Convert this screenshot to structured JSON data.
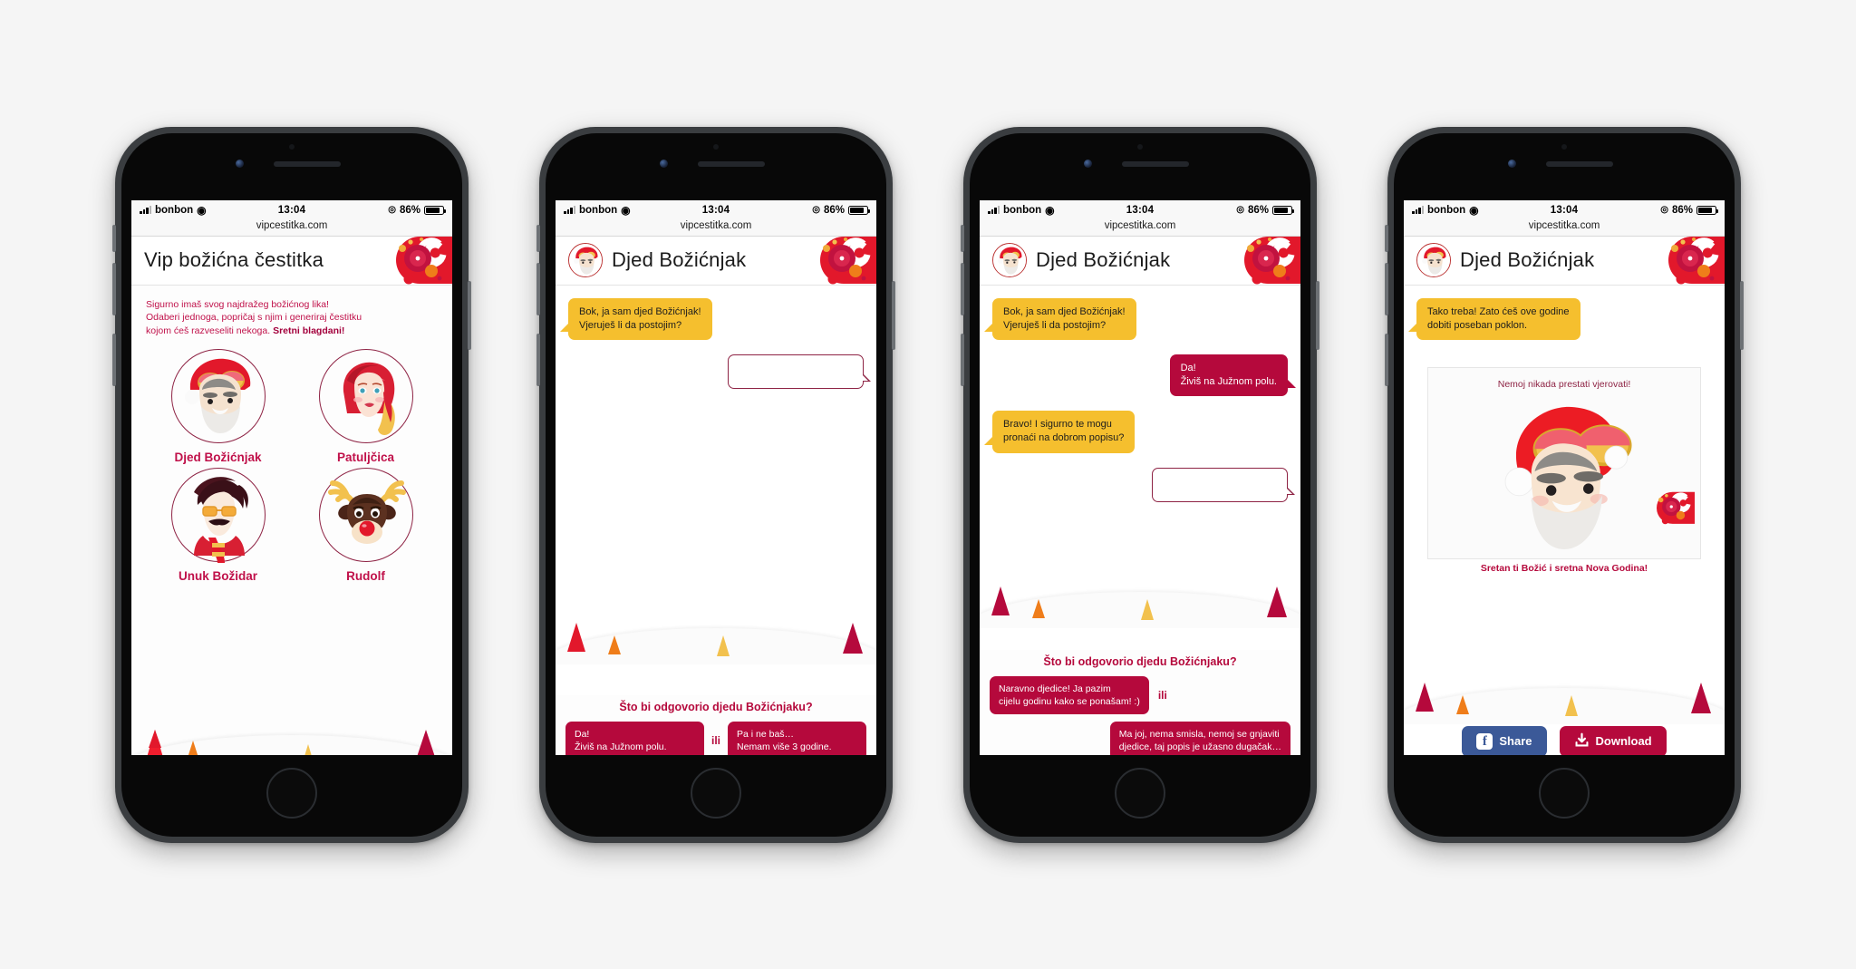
{
  "status_bar": {
    "carrier": "bonbon",
    "time": "13:04",
    "battery_percent": "86%",
    "wifi_icon": "wifi-icon",
    "signal_icon": "signal-bars-icon",
    "location_icon": "location-arrow-icon",
    "battery_icon": "battery-icon"
  },
  "browser": {
    "url": "vipcestitka.com"
  },
  "brand": {
    "logo_name": "vip-bubbles-logo",
    "accent_red": "#b5093c",
    "accent_yellow": "#f5bf2e",
    "dark_red": "#8e2344"
  },
  "phones": [
    {
      "id": "phone-1-character-select",
      "header": {
        "title": "Vip božićna čestitka",
        "has_avatar": false
      },
      "intro": {
        "line1": "Sigurno imaš svog najdražeg božićnog lika!",
        "line2": "Odaberi jednoga, popričaj s njim i generiraj čestitku",
        "line3_plain": "kojom ćeš razveseliti nekoga. ",
        "line3_bold": "Sretni blagdani!"
      },
      "characters": [
        {
          "name": "Djed Božićnjak",
          "avatar": "santa-avatar"
        },
        {
          "name": "Patuljčica",
          "avatar": "elf-girl-avatar"
        },
        {
          "name": "Unuk Božidar",
          "avatar": "hipster-grandson-avatar"
        },
        {
          "name": "Rudolf",
          "avatar": "reindeer-avatar"
        }
      ]
    },
    {
      "id": "phone-2-chat-start",
      "header": {
        "title": "Djed Božićnjak",
        "has_avatar": true,
        "avatar": "santa-avatar"
      },
      "messages": [
        {
          "from": "santa",
          "text": "Bok, ja sam djed Božićnjak!\nVjeruješ li da postojim?"
        },
        {
          "from": "me",
          "text": "",
          "empty": true
        }
      ],
      "answers": {
        "question": "Što bi odgovorio djedu Božićnjaku?",
        "separator": "ili",
        "options": [
          "Da!\nŽiviš na Južnom polu.",
          "Pa i ne baš…\nNemam više 3 godine."
        ]
      }
    },
    {
      "id": "phone-3-chat-second",
      "header": {
        "title": "Djed Božićnjak",
        "has_avatar": true,
        "avatar": "santa-avatar"
      },
      "messages": [
        {
          "from": "santa",
          "text": "Bok, ja sam djed Božićnjak!\nVjeruješ li da postojim?"
        },
        {
          "from": "me",
          "text": "Da!\nŽiviš na Južnom polu."
        },
        {
          "from": "santa",
          "text": "Bravo! I sigurno te mogu\npronaći na dobrom popisu?"
        },
        {
          "from": "me",
          "text": "",
          "empty": true
        }
      ],
      "answers": {
        "question": "Što bi odgovorio djedu Božićnjaku?",
        "separator": "ili",
        "options": [
          "Naravno djedice! Ja pazim\ncijelu godinu kako se ponašam! :)",
          "Ma joj, nema smisla, nemoj se gnjaviti\ndjedice, taj popis je užasno dugačak…"
        ]
      }
    },
    {
      "id": "phone-4-result-card",
      "header": {
        "title": "Djed Božićnjak",
        "has_avatar": true,
        "avatar": "santa-avatar"
      },
      "messages": [
        {
          "from": "santa",
          "text": "Tako treba! Zato ćeš ove godine\ndobiti poseban poklon."
        }
      ],
      "card": {
        "title": "Nemoj nikada prestati vjerovati!",
        "caption": "Sretan ti Božić i sretna Nova Godina!",
        "image": "santa-face-illustration",
        "logo": "vip-bubbles-logo"
      },
      "cta": {
        "share_label": "Share",
        "share_icon": "facebook-icon",
        "download_label": "Download",
        "download_icon": "download-icon"
      }
    }
  ]
}
